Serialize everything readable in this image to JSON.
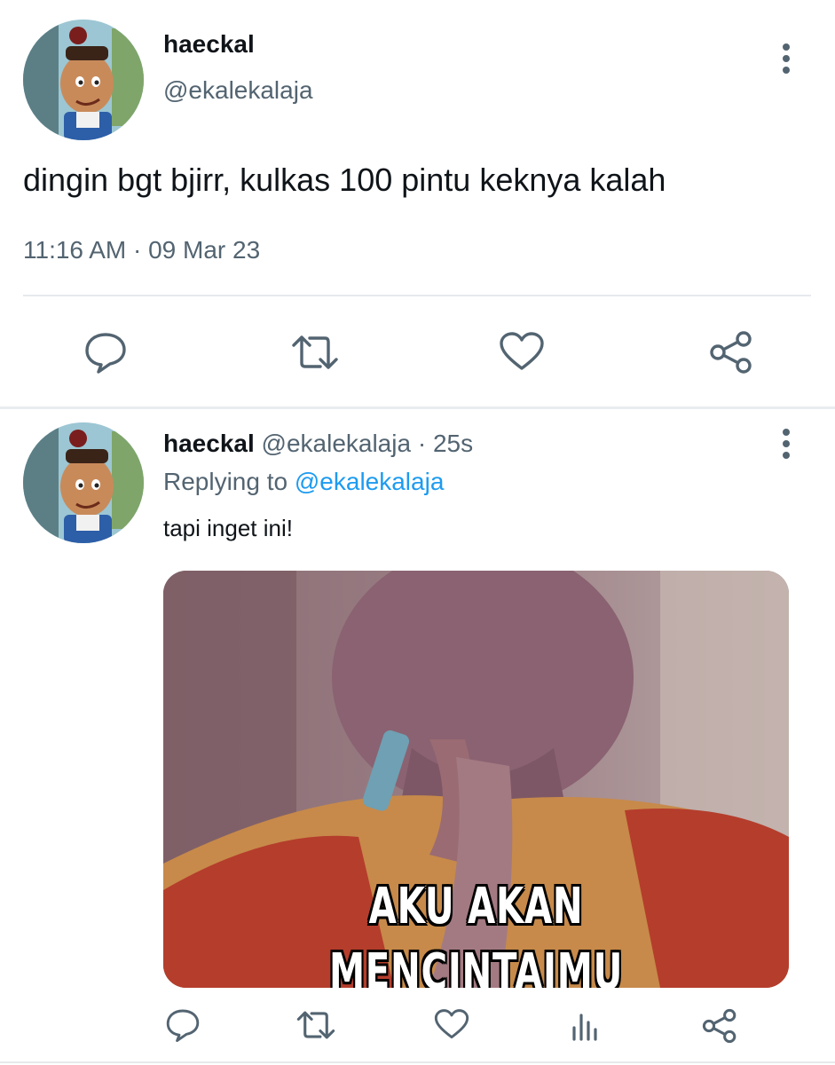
{
  "main_tweet": {
    "display_name": "haeckal",
    "handle": "@ekalekalaja",
    "text": "dingin bgt bjirr, kulkas 100 pintu keknya kalah",
    "timestamp": "11:16 AM · 09 Mar 23",
    "actions": [
      "reply-icon",
      "retweet-icon",
      "like-icon",
      "share-icon"
    ]
  },
  "reply_tweet": {
    "display_name": "haeckal",
    "handle": "@ekalekalaja",
    "time": "· 25s",
    "replying_label": "Replying to",
    "replying_handle": "@ekalekalaja",
    "text": "tapi inget ini!",
    "media": {
      "caption_line1": "AKU AKAN",
      "caption_line2": "MENCINTAIMU SELALU"
    },
    "actions": [
      "reply-icon",
      "retweet-icon",
      "like-icon",
      "analytics-icon",
      "share-icon"
    ]
  },
  "colors": {
    "text": "#0f1419",
    "muted": "#536471",
    "link": "#1d9bf0",
    "icon": "#536471"
  }
}
